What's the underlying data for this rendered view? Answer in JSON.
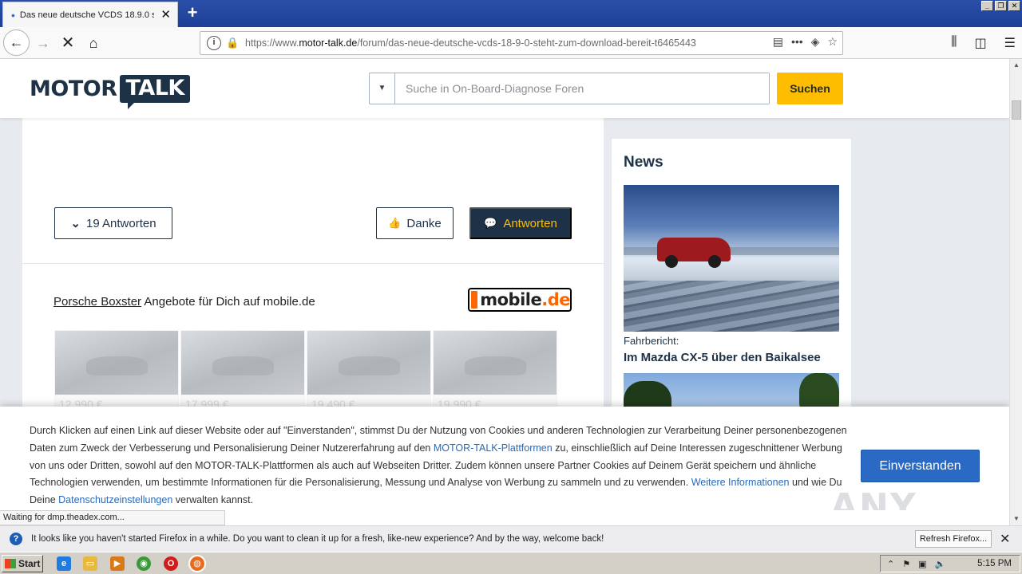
{
  "browser": {
    "tab_title": "Das neue deutsche VCDS 18.9.0 s",
    "url_prefix": "https://www.",
    "url_domain": "motor-talk.de",
    "url_path": "/forum/das-neue-deutsche-vcds-18-9-0-steht-zum-download-bereit-t6465443",
    "status_text": "Waiting for dmp.theadex.com..."
  },
  "header": {
    "logo_left": "MOTOR",
    "logo_right": "TALK",
    "search_placeholder": "Suche in On-Board-Diagnose Foren",
    "search_button": "Suchen"
  },
  "thread": {
    "answers_label": "19 Antworten",
    "danke_label": "Danke",
    "antworten_label": "Antworten"
  },
  "ad": {
    "model_link": "Porsche Boxster",
    "tagline": " Angebote für Dich auf mobile.de",
    "logo_text": "mobile",
    "logo_suffix": ".de",
    "cars": [
      {
        "price": "12.990 €"
      },
      {
        "price": "17.999 €"
      },
      {
        "price": "19.490 €"
      },
      {
        "price": "19.990 €"
      },
      {
        "price": ""
      },
      {
        "price": ""
      },
      {
        "price": ""
      },
      {
        "price": ""
      }
    ]
  },
  "sidebar": {
    "title": "News",
    "items": [
      {
        "category": "Fahrbericht:",
        "title": "Im Mazda CX-5 über den Baikalsee"
      }
    ]
  },
  "cookie": {
    "text_1": "Durch Klicken auf einen Link auf dieser Website oder auf \"Einverstanden\", stimmst Du der Nutzung von Cookies und anderen Technologien zur Verarbeitung Deiner personenbezogenen Daten zum Zweck der Verbesserung und Personalisierung Deiner Nutzererfahrung auf den ",
    "link_platforms": "MOTOR-TALK-Plattformen",
    "text_2": " zu, einschließlich auf Deine Interessen zugeschnittener Werbung von uns oder Dritten, sowohl auf den MOTOR-TALK-Plattformen als auch auf Webseiten Dritter. Zudem können unsere Partner Cookies auf Deinem Gerät speichern und ähnliche Technologien verwenden, um bestimmte Informationen für die Personalisierung, Messung und Analyse von Werbung zu sammeln und zu verwenden. ",
    "link_more": "Weitere Informationen",
    "text_3": " und wie Du Deine ",
    "link_privacy": "Datenschutzeinstellungen",
    "text_4": " verwalten kannst.",
    "agree_button": "Einverstanden",
    "watermark": "ANY RUN"
  },
  "notification": {
    "message": "It looks like you haven't started Firefox in a while. Do you want to clean it up for a fresh, like-new experience? And by the way, welcome back!",
    "refresh_button": "Refresh Firefox..."
  },
  "taskbar": {
    "start_label": "Start",
    "time": "5:15 PM"
  },
  "colors": {
    "brand_navy": "#1d3246",
    "brand_yellow": "#ffbd00",
    "cookie_button": "#2a6ac4",
    "link_blue": "#2a6ab8"
  }
}
